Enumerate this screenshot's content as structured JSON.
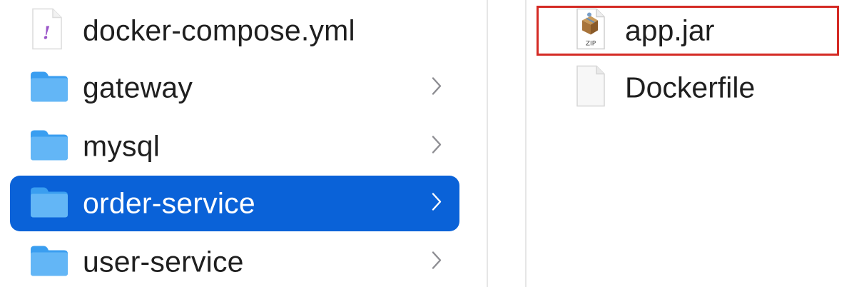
{
  "left_column": {
    "items": [
      {
        "label": "docker-compose.yml",
        "kind": "file",
        "icon": "yaml-file-icon",
        "has_chevron": false,
        "selected": false
      },
      {
        "label": "gateway",
        "kind": "folder",
        "icon": "folder-icon",
        "has_chevron": true,
        "selected": false
      },
      {
        "label": "mysql",
        "kind": "folder",
        "icon": "folder-icon",
        "has_chevron": true,
        "selected": false
      },
      {
        "label": "order-service",
        "kind": "folder",
        "icon": "folder-icon",
        "has_chevron": true,
        "selected": true
      },
      {
        "label": "user-service",
        "kind": "folder",
        "icon": "folder-icon",
        "has_chevron": true,
        "selected": false
      }
    ]
  },
  "right_column": {
    "items": [
      {
        "label": "app.jar",
        "icon": "jar-archive-icon",
        "icon_text": "ZIP",
        "highlighted": true
      },
      {
        "label": "Dockerfile",
        "icon": "blank-document-icon",
        "highlighted": false
      }
    ]
  },
  "colors": {
    "selection": "#0a62d8",
    "folder": "#3a9ef0",
    "highlight_border": "#d42a24",
    "text": "#1f1f1f",
    "chevron": "#8e8e93"
  }
}
